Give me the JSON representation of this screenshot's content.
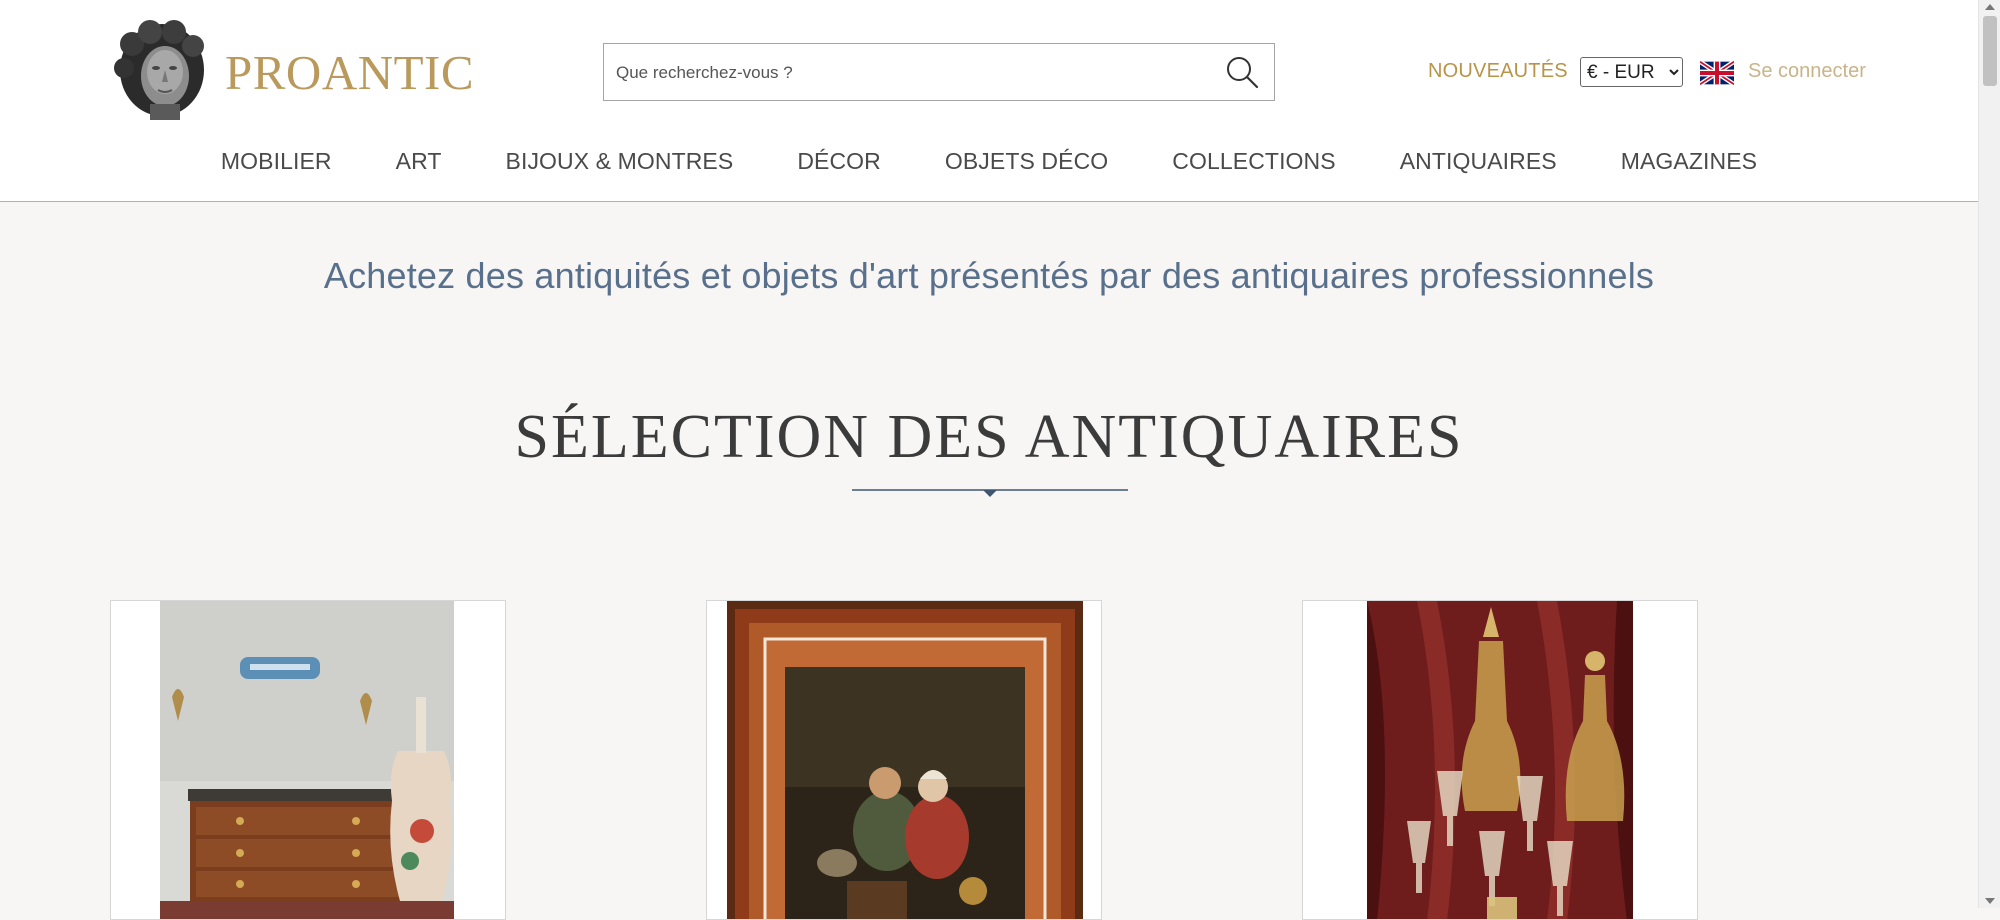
{
  "header": {
    "logo_text": "PROANTIC",
    "search_placeholder": "Que recherchez-vous ?",
    "nouveautes_label": "NOUVEAUTÉS",
    "currency_selected": "€ - EUR",
    "login_label": "Se connecter"
  },
  "nav": {
    "items": [
      "MOBILIER",
      "ART",
      "BIJOUX & MONTRES",
      "DÉCOR",
      "OBJETS DÉCO",
      "COLLECTIONS",
      "ANTIQUAIRES",
      "MAGAZINES"
    ]
  },
  "main": {
    "tagline": "Achetez des antiquités et objets d'art présentés par des antiquaires professionnels",
    "section_title": "SÉLECTION DES ANTIQUAIRES"
  },
  "colors": {
    "brand_gold": "#b99a5c",
    "nav_text": "#4a4a4a",
    "tagline_blue": "#58708c",
    "background": "#f7f6f4"
  },
  "icons": [
    "search-icon",
    "uk-flag-icon",
    "logo-bust-icon"
  ]
}
